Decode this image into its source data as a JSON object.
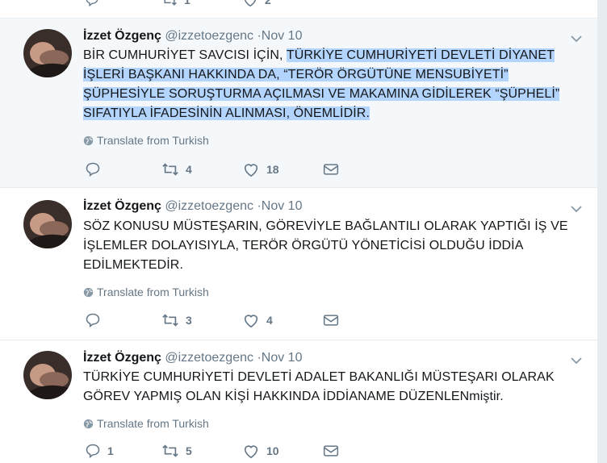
{
  "top_partial": {
    "retweets": "1",
    "likes": "2"
  },
  "tweets": [
    {
      "name": "İzzet Özgenç",
      "handle": "@izzetoezgenc",
      "date": "·Nov 10",
      "lines": [
        {
          "plain": "BİR CUMHURİYET SAVCISI İÇİN, ",
          "hl": "TÜRKİYE CUMHURİYETİ DEVLETİ DİYANET"
        },
        {
          "plain": "",
          "hl": "İŞLERİ BAŞKANI HAKKINDA DA, “TERÖR ÖRGÜTÜNE MENSUBİYETİ”"
        },
        {
          "plain": "",
          "hl": "ŞÜPHESİYLE SORUŞTURMA AÇILMASI VE MAKAMINA GİDİLEREK “ŞÜPHELİ”"
        },
        {
          "plain": "",
          "hl": "SIFATIYLA İFADESİNİN ALINMASI, ÖNEMLİDİR."
        }
      ],
      "translate": "Translate from Turkish",
      "replies": "",
      "retweets": "4",
      "likes": "18"
    },
    {
      "name": "İzzet Özgenç",
      "handle": "@izzetoezgenc",
      "date": "·Nov 10",
      "lines": [
        {
          "plain": "SÖZ KONUSU MÜSTEŞARIN, GÖREVİYLE BAĞLANTILI OLARAK YAPTIĞI İŞ VE",
          "hl": ""
        },
        {
          "plain": "İŞLEMLER DOLAYISIYLA, TERÖR ÖRGÜTÜ YÖNETİCİSİ OLDUĞU İDDİA",
          "hl": ""
        },
        {
          "plain": "EDİLMEKTEDİR.",
          "hl": ""
        }
      ],
      "translate": "Translate from Turkish",
      "replies": "",
      "retweets": "3",
      "likes": "4"
    },
    {
      "name": "İzzet Özgenç",
      "handle": "@izzetoezgenc",
      "date": "·Nov 10",
      "lines": [
        {
          "plain": "TÜRKİYE CUMHURİYETİ DEVLETİ ADALET BAKANLIĞI MÜSTEŞARI OLARAK",
          "hl": ""
        },
        {
          "plain": "GÖREV YAPMIŞ OLAN KİŞİ HAKKINDA İDDİANAME DÜZENLENmiştir.",
          "hl": ""
        }
      ],
      "translate": "Translate from Turkish",
      "replies": "1",
      "retweets": "5",
      "likes": "10"
    }
  ],
  "colors": {
    "highlight": "#b3d4fc",
    "muted": "#657786",
    "focused_bg": "#f5f8fa"
  }
}
